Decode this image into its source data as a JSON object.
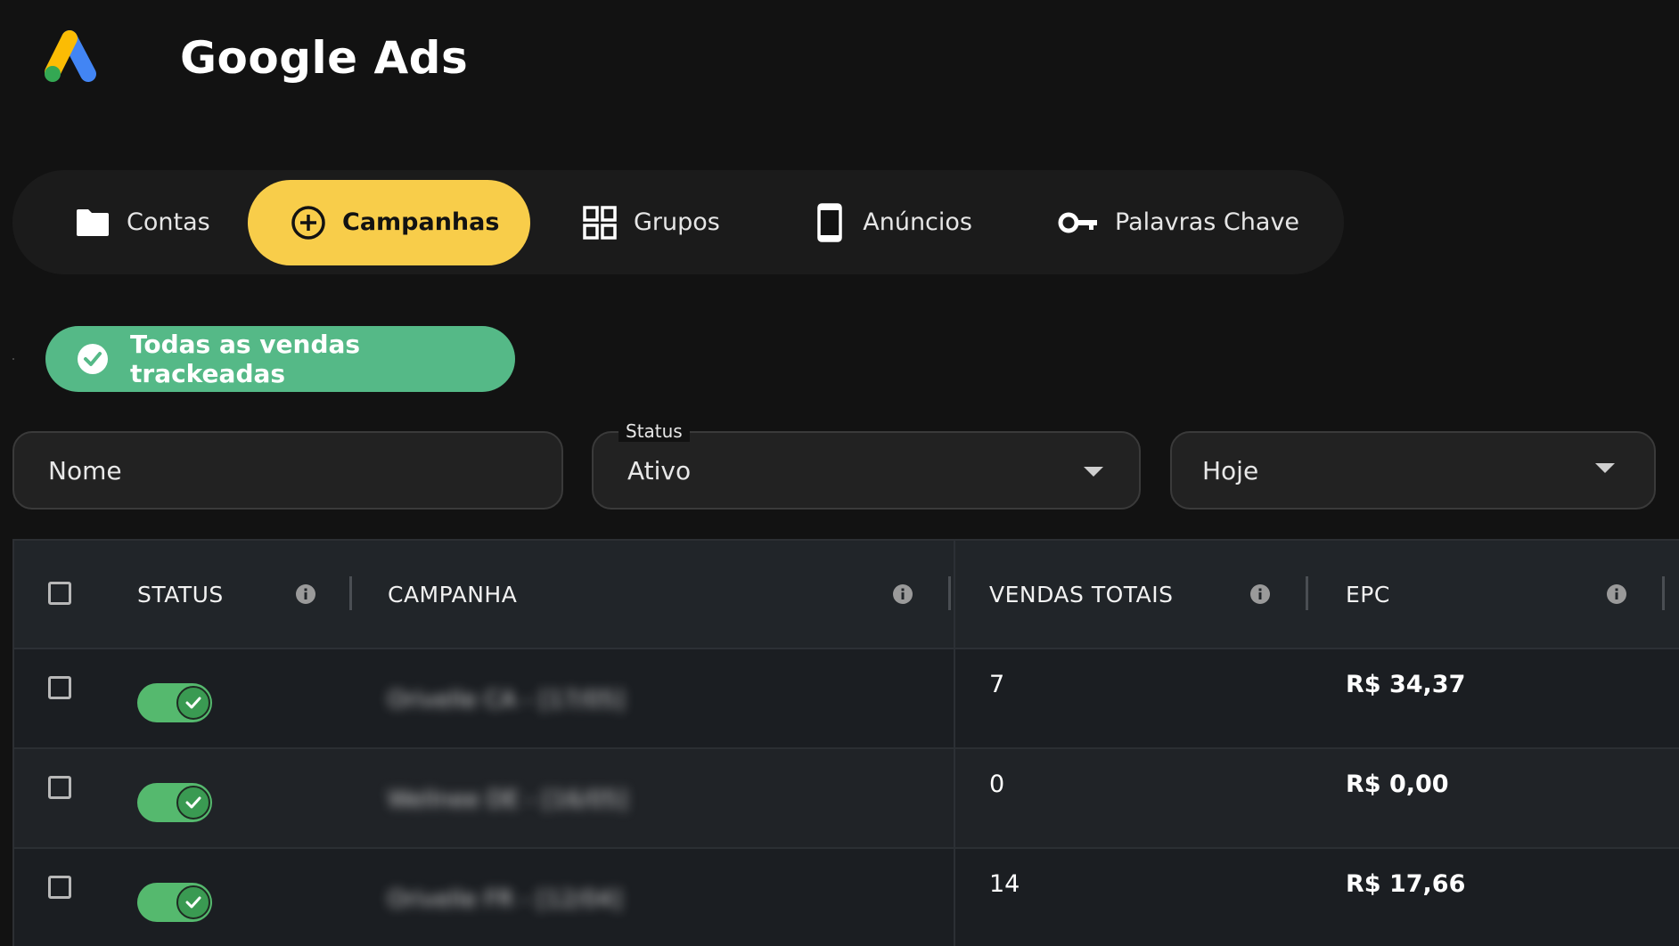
{
  "header": {
    "title": "Google Ads",
    "logo_icon": "google-ads-logo"
  },
  "tabs": [
    {
      "label": "Contas",
      "icon": "folder-icon",
      "active": false
    },
    {
      "label": "Campanhas",
      "icon": "plus-circle-icon",
      "active": true
    },
    {
      "label": "Grupos",
      "icon": "grid-icon",
      "active": false
    },
    {
      "label": "Anúncios",
      "icon": "phone-icon",
      "active": false
    },
    {
      "label": "Palavras Chave",
      "icon": "key-icon",
      "active": false
    }
  ],
  "banner": {
    "label": "Todas as vendas trackeadas",
    "color": "#55b987"
  },
  "filters": {
    "name_placeholder": "Nome",
    "status_label": "Status",
    "status_value": "Ativo",
    "date_value": "Hoje"
  },
  "table": {
    "columns": [
      "STATUS",
      "CAMPANHA",
      "VENDAS TOTAIS",
      "EPC"
    ],
    "rows": [
      {
        "status_on": true,
        "campaign": "Orivelle CA - [17/05]",
        "vendas": "7",
        "epc": "R$ 34,37"
      },
      {
        "status_on": true,
        "campaign": "Wellnee DE - [16/05]",
        "vendas": "0",
        "epc": "R$ 0,00"
      },
      {
        "status_on": true,
        "campaign": "Orivelle FR - [12/04]",
        "vendas": "14",
        "epc": "R$ 17,66"
      }
    ]
  },
  "colors": {
    "accent": "#f8cd4a",
    "success": "#55b987",
    "background": "#121212"
  }
}
